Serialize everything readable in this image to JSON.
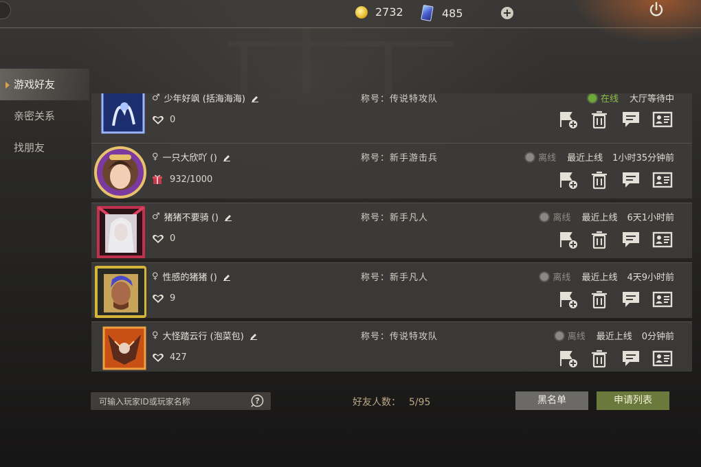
{
  "resources": {
    "coins": "2732",
    "cards": "485"
  },
  "sidebar": {
    "items": [
      {
        "label": "游戏好友",
        "active": true
      },
      {
        "label": "亲密关系",
        "active": false
      },
      {
        "label": "找朋友",
        "active": false
      }
    ]
  },
  "friends": [
    {
      "gender": "♂",
      "name": "少年好飒 (括海海海)",
      "stat": "0",
      "stat_type": "heart",
      "title": "称号：传说特攻队",
      "online": true,
      "status": "在线",
      "status_label": "",
      "status_time": "大厅等待中"
    },
    {
      "gender": "♀",
      "name": "一只大欣吖 ()",
      "stat": "932/1000",
      "stat_type": "gift",
      "title": "称号：新手游击兵",
      "online": false,
      "status": "离线",
      "status_label": "最近上线",
      "status_time": "1小时35分钟前"
    },
    {
      "gender": "♂",
      "name": "猪猪不要骑 ()",
      "stat": "0",
      "stat_type": "heart",
      "title": "称号：新手凡人",
      "online": false,
      "status": "离线",
      "status_label": "最近上线",
      "status_time": "6天1小时前"
    },
    {
      "gender": "♀",
      "name": "性感的猪猪 ()",
      "stat": "9",
      "stat_type": "heart",
      "title": "称号：新手凡人",
      "online": false,
      "status": "离线",
      "status_label": "最近上线",
      "status_time": "4天9小时前"
    },
    {
      "gender": "♀",
      "name": "大怪踏云行 (泡菜包)",
      "stat": "427",
      "stat_type": "heart",
      "title": "称号：传说特攻队",
      "online": false,
      "status": "离线",
      "status_label": "最近上线",
      "status_time": "0分钟前"
    }
  ],
  "action_icons": [
    "flag-add-icon",
    "trash-icon",
    "chat-icon",
    "profile-card-icon"
  ],
  "footer": {
    "search_placeholder": "可输入玩家ID或玩家名称",
    "count_label": "好友人数：",
    "count_value": "5/95",
    "blacklist_label": "黑名单",
    "requests_label": "申请列表"
  },
  "colors": {
    "online": "#6da83a",
    "offline": "#8a8884",
    "apply_button": "#6b7a3c",
    "count_text": "#bda885"
  }
}
